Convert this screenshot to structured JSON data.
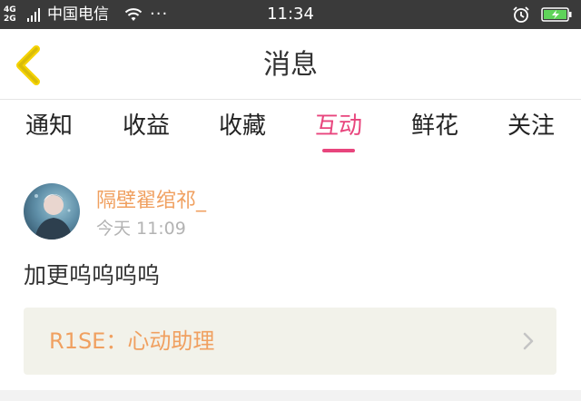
{
  "status_bar": {
    "net_top": "4G",
    "net_bottom": "2G",
    "carrier": "中国电信",
    "more": "···",
    "time": "11:34",
    "icons": [
      "signal-icon",
      "wifi-icon",
      "alarm-icon",
      "battery-charging-icon"
    ]
  },
  "header": {
    "title": "消息",
    "back_icon": "chevron-left-icon",
    "accent_color": "#f5d300"
  },
  "tabs": [
    {
      "label": "通知",
      "active": false
    },
    {
      "label": "收益",
      "active": false
    },
    {
      "label": "收藏",
      "active": false
    },
    {
      "label": "互动",
      "active": true
    },
    {
      "label": "鲜花",
      "active": false
    },
    {
      "label": "关注",
      "active": false
    }
  ],
  "message": {
    "username": "隔壁翟绾祁_",
    "timestamp": "今天 11:09",
    "content": "加更呜呜呜呜",
    "link_card": {
      "title": "R1SE：心动助理",
      "icon": "chevron-right-icon"
    }
  },
  "colors": {
    "active_tab": "#e8457d",
    "username": "#f0a060",
    "card_bg": "#f2f2ea"
  }
}
